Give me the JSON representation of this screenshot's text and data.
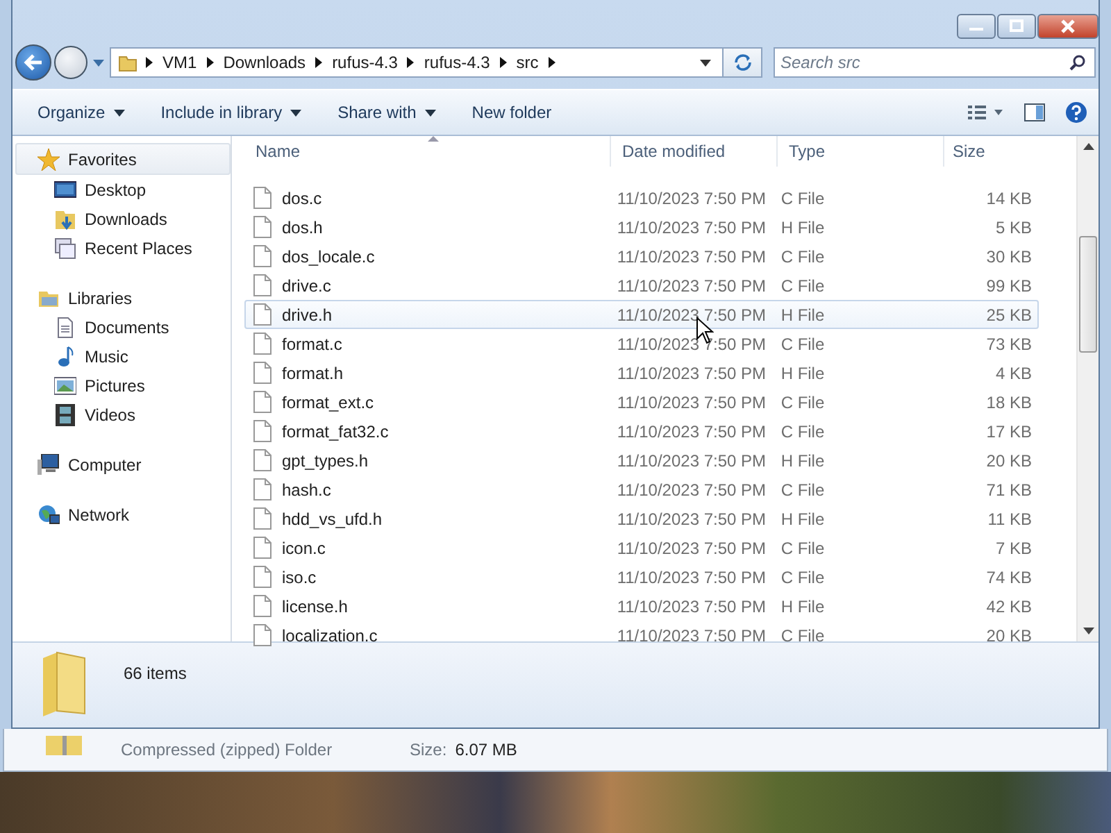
{
  "address_bar": {
    "crumbs": [
      "VM1",
      "Downloads",
      "rufus-4.3",
      "rufus-4.3",
      "src"
    ]
  },
  "search": {
    "placeholder": "Search src"
  },
  "toolbar": {
    "items": [
      {
        "label": "Organize",
        "dropdown": true
      },
      {
        "label": "Include in library",
        "dropdown": true
      },
      {
        "label": "Share with",
        "dropdown": true
      },
      {
        "label": "New folder",
        "dropdown": false
      }
    ]
  },
  "nav": [
    {
      "label": "Favorites",
      "kind": "star",
      "selected": true,
      "children": [
        {
          "label": "Desktop",
          "kind": "desktop",
          "selected": false
        },
        {
          "label": "Downloads",
          "kind": "downloads",
          "selected": false
        },
        {
          "label": "Recent Places",
          "kind": "recent",
          "selected": false
        }
      ]
    },
    {
      "label": "Libraries",
      "kind": "libraries",
      "selected": false,
      "children": [
        {
          "label": "Documents",
          "kind": "documents",
          "selected": false
        },
        {
          "label": "Music",
          "kind": "music",
          "selected": false
        },
        {
          "label": "Pictures",
          "kind": "pictures",
          "selected": false
        },
        {
          "label": "Videos",
          "kind": "videos",
          "selected": false
        }
      ]
    },
    {
      "label": "Computer",
      "kind": "computer",
      "selected": false
    },
    {
      "label": "Network",
      "kind": "network",
      "selected": false
    }
  ],
  "table": {
    "columns": [
      "Name",
      "Date modified",
      "Type",
      "Size"
    ],
    "rows": [
      {
        "name": "dos.c",
        "date": "11/10/2023 7:50 PM",
        "type": "C File",
        "size": "14 KB",
        "hovered": false
      },
      {
        "name": "dos.h",
        "date": "11/10/2023 7:50 PM",
        "type": "H File",
        "size": "5 KB",
        "hovered": false
      },
      {
        "name": "dos_locale.c",
        "date": "11/10/2023 7:50 PM",
        "type": "C File",
        "size": "30 KB",
        "hovered": false
      },
      {
        "name": "drive.c",
        "date": "11/10/2023 7:50 PM",
        "type": "C File",
        "size": "99 KB",
        "hovered": false
      },
      {
        "name": "drive.h",
        "date": "11/10/2023 7:50 PM",
        "type": "H File",
        "size": "25 KB",
        "hovered": true
      },
      {
        "name": "format.c",
        "date": "11/10/2023 7:50 PM",
        "type": "C File",
        "size": "73 KB",
        "hovered": false
      },
      {
        "name": "format.h",
        "date": "11/10/2023 7:50 PM",
        "type": "H File",
        "size": "4 KB",
        "hovered": false
      },
      {
        "name": "format_ext.c",
        "date": "11/10/2023 7:50 PM",
        "type": "C File",
        "size": "18 KB",
        "hovered": false
      },
      {
        "name": "format_fat32.c",
        "date": "11/10/2023 7:50 PM",
        "type": "C File",
        "size": "17 KB",
        "hovered": false
      },
      {
        "name": "gpt_types.h",
        "date": "11/10/2023 7:50 PM",
        "type": "H File",
        "size": "20 KB",
        "hovered": false
      },
      {
        "name": "hash.c",
        "date": "11/10/2023 7:50 PM",
        "type": "C File",
        "size": "71 KB",
        "hovered": false
      },
      {
        "name": "hdd_vs_ufd.h",
        "date": "11/10/2023 7:50 PM",
        "type": "H File",
        "size": "11 KB",
        "hovered": false
      },
      {
        "name": "icon.c",
        "date": "11/10/2023 7:50 PM",
        "type": "C File",
        "size": "7 KB",
        "hovered": false
      },
      {
        "name": "iso.c",
        "date": "11/10/2023 7:50 PM",
        "type": "C File",
        "size": "74 KB",
        "hovered": false
      },
      {
        "name": "license.h",
        "date": "11/10/2023 7:50 PM",
        "type": "H File",
        "size": "42 KB",
        "hovered": false
      },
      {
        "name": "localization.c",
        "date": "11/10/2023 7:50 PM",
        "type": "C File",
        "size": "20 KB",
        "hovered": false
      }
    ]
  },
  "details": {
    "count": "66 items"
  },
  "background_window": {
    "type_label": "Compressed (zipped) Folder",
    "size_label": "Size:",
    "size_value": "6.07 MB"
  }
}
